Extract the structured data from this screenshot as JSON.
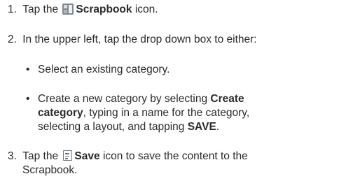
{
  "steps": [
    {
      "number": "1.",
      "text_before": "Tap the",
      "icon": "scrapbook-icon",
      "bold": "Scrapbook",
      "text_after": "icon."
    },
    {
      "number": "2.",
      "text": "In the upper left, tap the drop down box to either:",
      "bullets": [
        {
          "text": "Select an existing category."
        },
        {
          "line1_text": "Create a new category by selecting",
          "line1_bold": "Create",
          "line2_bold": "category",
          "line2_text": ", typing in a name for the category,",
          "line3_text": "selecting a layout, and tapping",
          "line3_bold": "SAVE",
          "line3_end": "."
        }
      ]
    },
    {
      "number": "3.",
      "text_before": "Tap the",
      "icon": "save-icon",
      "bold": "Save",
      "text_after": "icon to save the content to the",
      "line2": "Scrapbook."
    }
  ],
  "bullet_symbol": "•",
  "colors": {
    "text": "#2b2b2b",
    "icon": "#7e8a93"
  }
}
